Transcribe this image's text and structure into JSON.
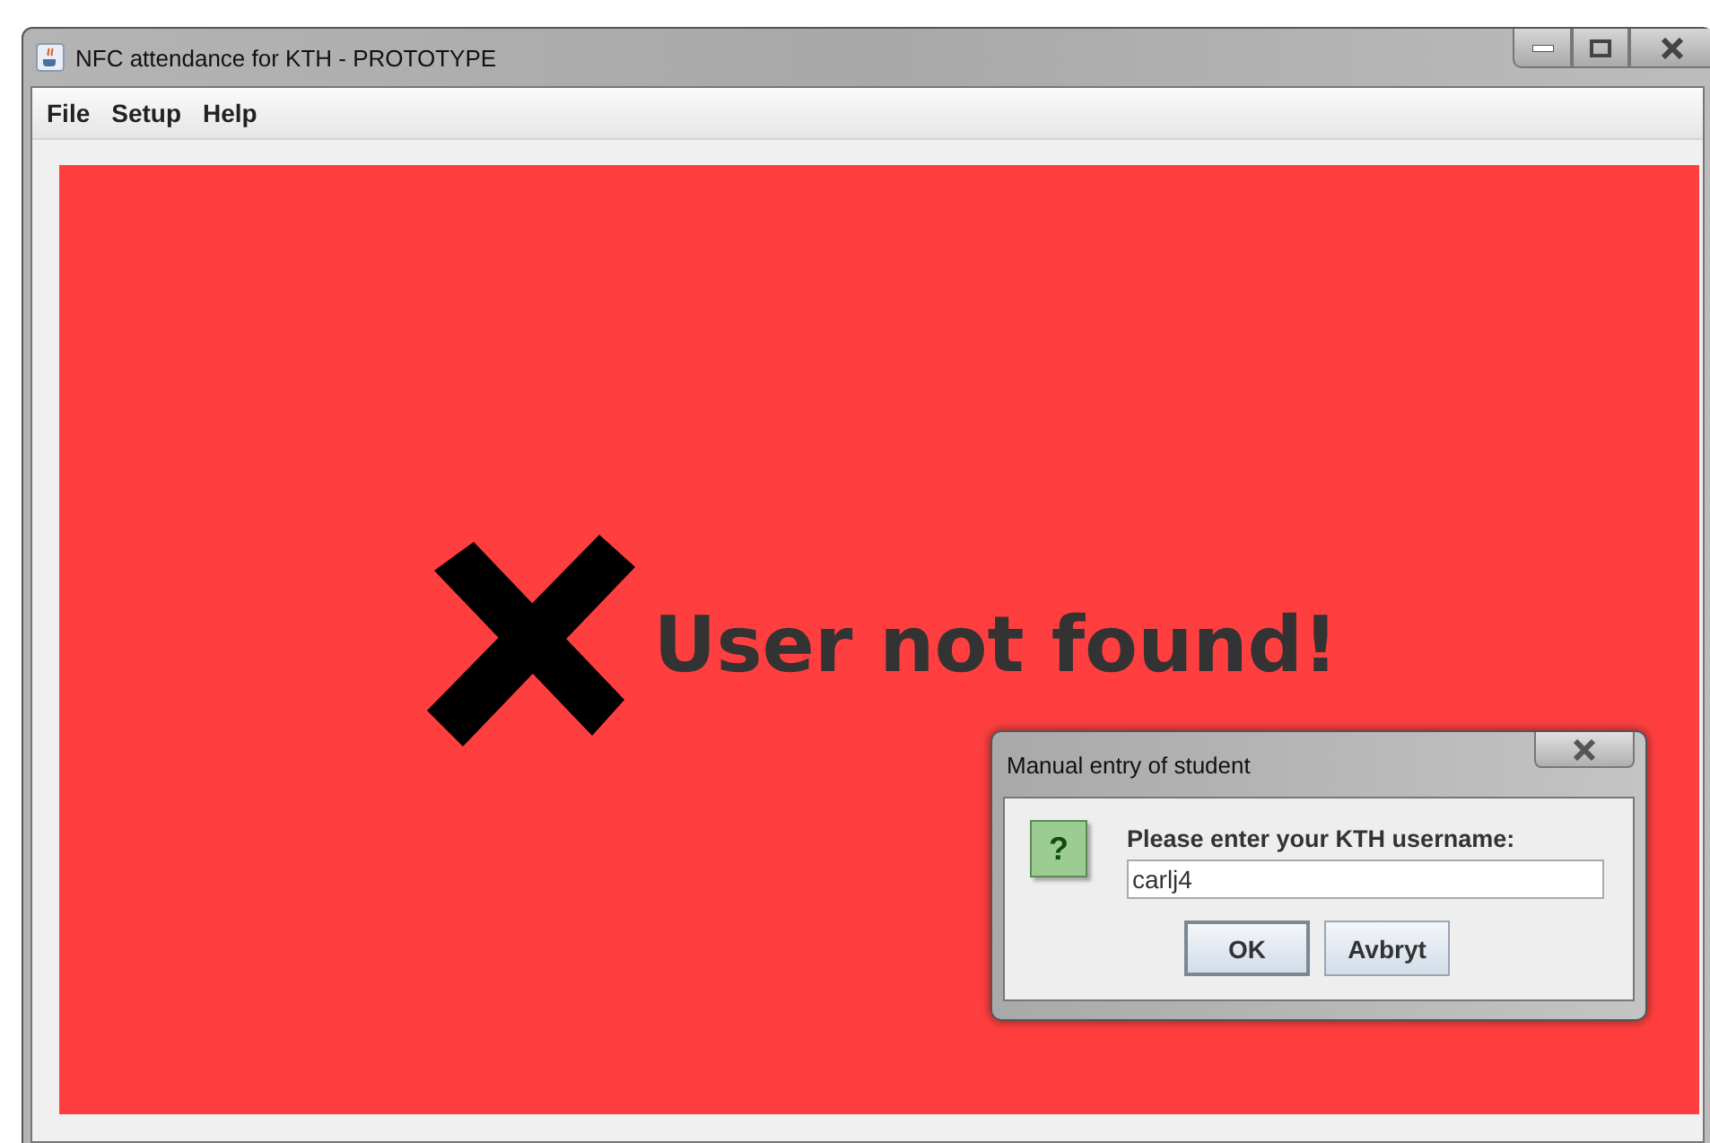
{
  "window": {
    "title": "NFC attendance for KTH - PROTOTYPE"
  },
  "menu": [
    "File",
    "Setup",
    "Help"
  ],
  "status": {
    "kind": "error",
    "message": "User not found!"
  },
  "dialog": {
    "title": "Manual entry of student",
    "prompt": "Please enter your KTH username:",
    "icon": "?",
    "value": "carlj4",
    "buttons": [
      "OK",
      "Avbryt"
    ]
  }
}
